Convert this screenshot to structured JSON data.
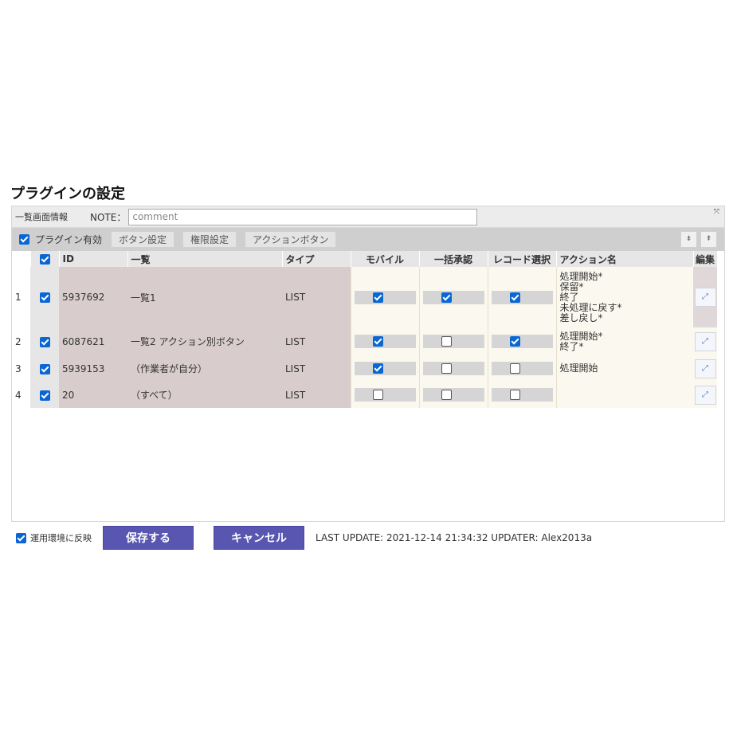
{
  "page": {
    "title": "プラグインの設定"
  },
  "info_bar": {
    "list_screen_label": "一覧画面情報",
    "note_label": "NOTE：",
    "note_placeholder": "comment",
    "note_value": ""
  },
  "toolbar": {
    "plugin_enabled_label": "プラグイン有効",
    "plugin_enabled": true,
    "button_settings_label": "ボタン設定",
    "permission_settings_label": "権限設定",
    "action_button_label": "アクションボタン",
    "move_down_symbol": "⇟",
    "move_up_symbol": "⇞"
  },
  "table": {
    "columns": {
      "id": "ID",
      "list": "一覧",
      "type": "タイプ",
      "mobile": "モバイル",
      "bulk_approve": "一括承認",
      "record_select": "レコード選択",
      "action_name": "アクション名",
      "edit": "編集"
    },
    "rows": [
      {
        "no": "1",
        "selected": true,
        "id": "5937692",
        "list": "一覧1",
        "type": "LIST",
        "mobile": true,
        "bulk_approve": true,
        "record_select": true,
        "actions": [
          "処理開始*",
          "保留*",
          "終了",
          "未処理に戻す*",
          "差し戻し*"
        ]
      },
      {
        "no": "2",
        "selected": true,
        "id": "6087621",
        "list": "一覧2 アクション別ボタン",
        "type": "LIST",
        "mobile": true,
        "bulk_approve": false,
        "record_select": true,
        "actions": [
          "処理開始*",
          "終了*"
        ]
      },
      {
        "no": "3",
        "selected": true,
        "id": "5939153",
        "list": "（作業者が自分）",
        "type": "LIST",
        "mobile": true,
        "bulk_approve": false,
        "record_select": false,
        "actions": [
          "処理開始"
        ]
      },
      {
        "no": "4",
        "selected": true,
        "id": "20",
        "list": "（すべて）",
        "type": "LIST",
        "mobile": false,
        "bulk_approve": false,
        "record_select": false,
        "actions": []
      }
    ]
  },
  "footer": {
    "apply_label": "運用環境に反映",
    "apply_checked": true,
    "save_label": "保存する",
    "cancel_label": "キャンセル",
    "last_update": "LAST UPDATE: 2021-12-14 21:34:32 UPDATER: Alex2013a"
  },
  "colors": {
    "primary_button": "#5856b0",
    "checkbox": "#0a66d4",
    "row_shade": "#d9cccc",
    "action_area": "#fbf9ef"
  }
}
